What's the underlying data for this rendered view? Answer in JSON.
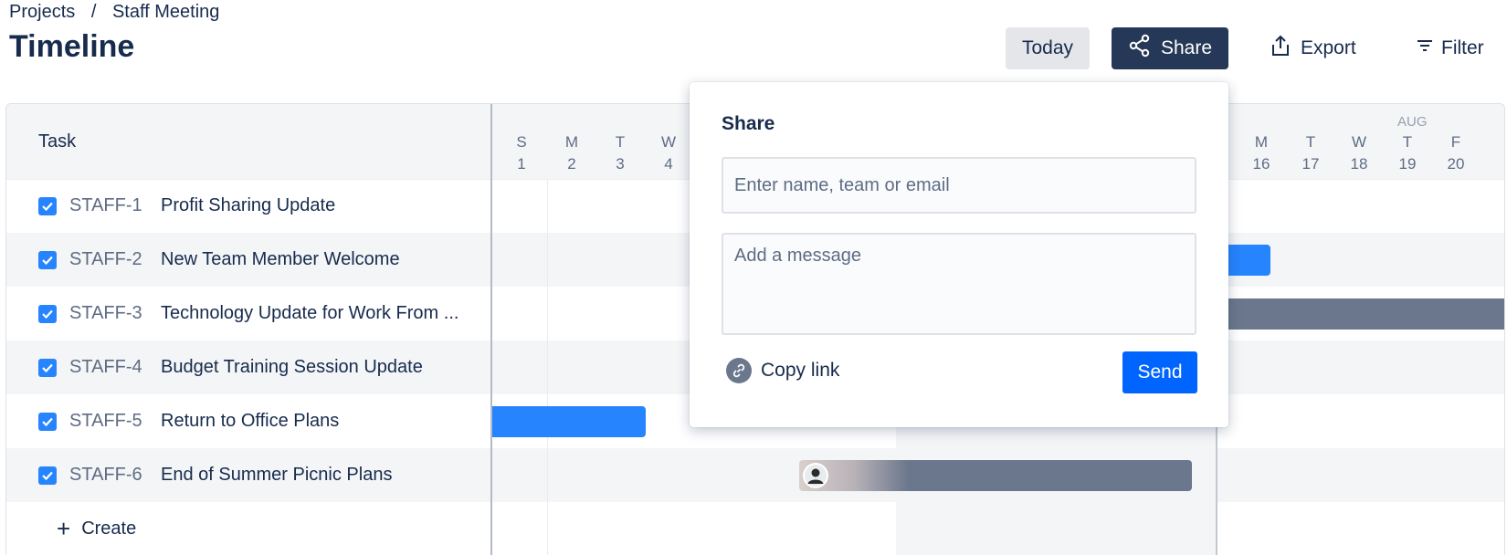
{
  "breadcrumb": {
    "projects": "Projects",
    "separator": "/",
    "current": "Staff Meeting"
  },
  "page": {
    "title": "Timeline"
  },
  "toolbar": {
    "today_label": "Today",
    "share_label": "Share",
    "export_label": "Export",
    "filter_label": "Filter"
  },
  "table": {
    "task_header": "Task",
    "rows": [
      {
        "key": "STAFF-1",
        "summary": "Profit Sharing Update",
        "checked": true
      },
      {
        "key": "STAFF-2",
        "summary": "New Team Member Welcome",
        "checked": true
      },
      {
        "key": "STAFF-3",
        "summary": "Technology Update for Work From ...",
        "checked": true
      },
      {
        "key": "STAFF-4",
        "summary": "Budget Training Session Update",
        "checked": true
      },
      {
        "key": "STAFF-5",
        "summary": "Return to Office Plans",
        "checked": true
      },
      {
        "key": "STAFF-6",
        "summary": "End of Summer Picnic Plans",
        "checked": true
      }
    ],
    "create_label": "Create"
  },
  "calendar": {
    "days_left": [
      {
        "dow": "S",
        "date": "1"
      },
      {
        "dow": "M",
        "date": "2"
      },
      {
        "dow": "T",
        "date": "3"
      },
      {
        "dow": "W",
        "date": "4"
      }
    ],
    "month_label": "AUG",
    "days_right": [
      {
        "dow": "M",
        "date": "16"
      },
      {
        "dow": "T",
        "date": "17"
      },
      {
        "dow": "W",
        "date": "18"
      },
      {
        "dow": "T",
        "date": "19"
      },
      {
        "dow": "F",
        "date": "20"
      }
    ]
  },
  "share_popup": {
    "title": "Share",
    "recipients_placeholder": "Enter name, team or email",
    "message_placeholder": "Add a message",
    "copy_link_label": "Copy link",
    "send_label": "Send"
  },
  "colors": {
    "bar_blue": "#2684ff",
    "bar_gray": "#6b778c",
    "share_button": "#253858",
    "send_button": "#0065ff"
  }
}
